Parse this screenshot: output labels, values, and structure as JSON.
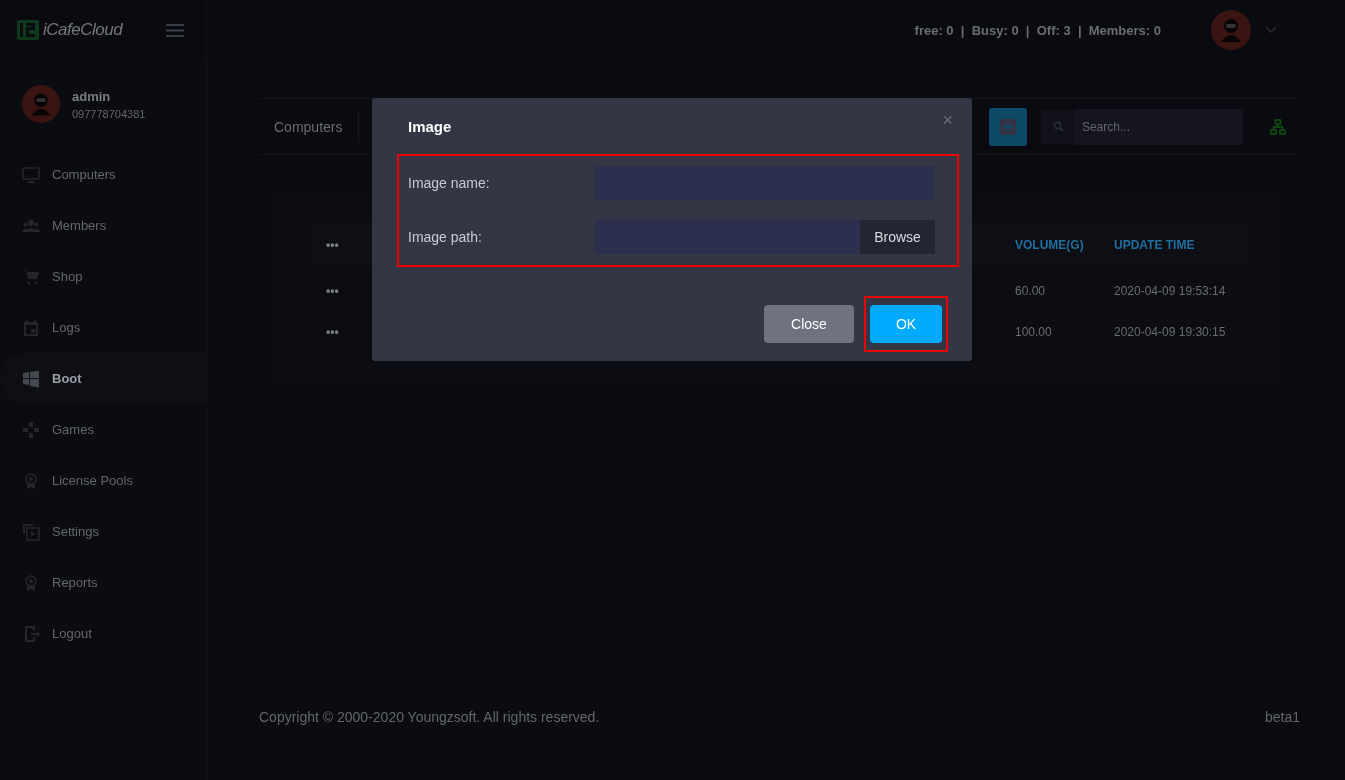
{
  "header": {
    "logo": "iCafeCloud",
    "stats": "free: 0  |  Busy: 0  |  Off: 3  |  Members: 0"
  },
  "user": {
    "name": "admin",
    "phone": "097778704381"
  },
  "sidebar": {
    "items": [
      {
        "label": "Computers",
        "selected": false
      },
      {
        "label": "Members",
        "selected": false
      },
      {
        "label": "Shop",
        "selected": false
      },
      {
        "label": "Logs",
        "selected": false
      },
      {
        "label": "Boot",
        "selected": true
      },
      {
        "label": "Games",
        "selected": false
      },
      {
        "label": "License Pools",
        "selected": false
      },
      {
        "label": "Settings",
        "selected": false
      },
      {
        "label": "Reports",
        "selected": false
      },
      {
        "label": "Logout",
        "selected": false
      }
    ]
  },
  "toolbar": {
    "tab": "Computers",
    "search": {
      "placeholder": "Search..."
    }
  },
  "table": {
    "columns": [
      "•••",
      "VOLUME(G)",
      "UPDATE TIME"
    ],
    "rows": [
      {
        "menu": "•••",
        "volume": "60.00",
        "update_time": "2020-04-09 19:53:14"
      },
      {
        "menu": "•••",
        "volume": "100.00",
        "update_time": "2020-04-09 19:30:15"
      }
    ]
  },
  "dialog": {
    "title": "Image",
    "close": "×",
    "highlighted": true,
    "fields": [
      {
        "kind": "text",
        "label": "Image name:"
      },
      {
        "kind": "file",
        "label": "Image path:",
        "button": "Browse"
      }
    ],
    "buttons": [
      {
        "kind": "secondary",
        "label": "Close",
        "highlighted": false
      },
      {
        "kind": "primary",
        "label": "OK",
        "highlighted": true
      }
    ]
  },
  "footer": {
    "copyright": "Copyright © 2000-2020 Youngzsoft. All rights reserved.",
    "version": "beta1"
  }
}
